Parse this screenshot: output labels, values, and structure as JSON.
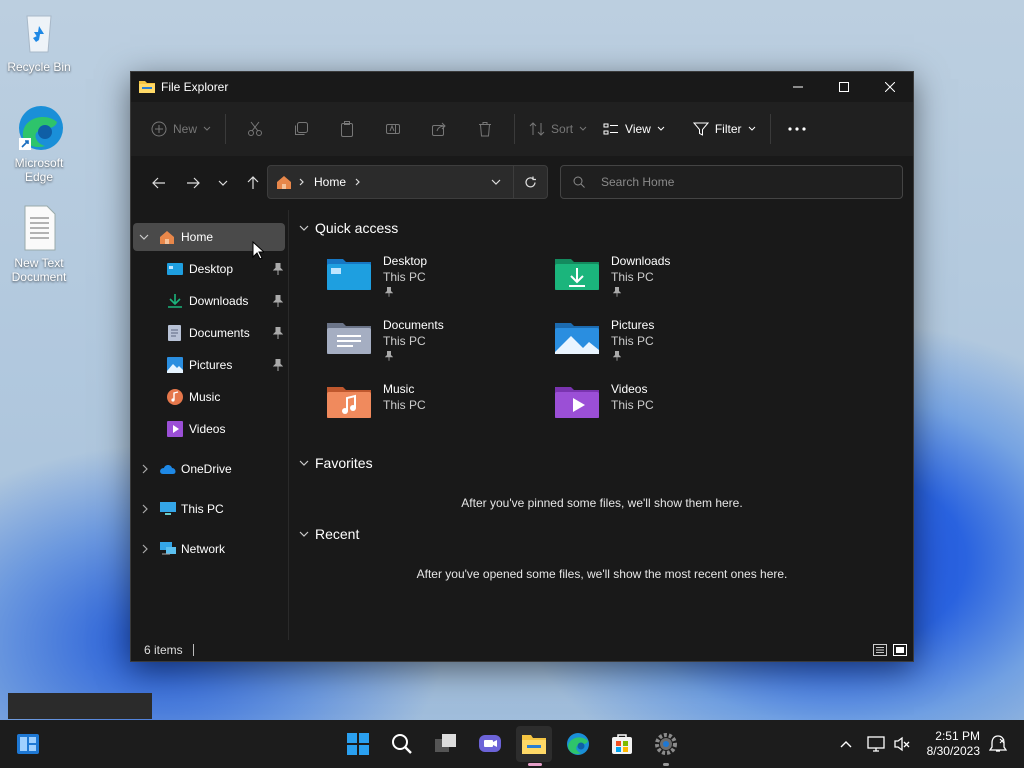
{
  "desktop": {
    "icons": [
      {
        "label": "Recycle Bin",
        "icon": "recycle-bin-icon"
      },
      {
        "label": "Microsoft Edge",
        "icon": "edge-icon"
      },
      {
        "label": "New Text Document",
        "icon": "text-document-icon"
      }
    ]
  },
  "window": {
    "title": "File Explorer",
    "toolbar": {
      "new_label": "New",
      "sort_label": "Sort",
      "view_label": "View",
      "filter_label": "Filter"
    },
    "address": {
      "location": "Home"
    },
    "search": {
      "placeholder": "Search Home"
    },
    "sidebar": {
      "home": "Home",
      "items": [
        {
          "label": "Desktop",
          "pinned": true
        },
        {
          "label": "Downloads",
          "pinned": true
        },
        {
          "label": "Documents",
          "pinned": true
        },
        {
          "label": "Pictures",
          "pinned": true
        },
        {
          "label": "Music",
          "pinned": false
        },
        {
          "label": "Videos",
          "pinned": false
        }
      ],
      "onedrive": "OneDrive",
      "thispc": "This PC",
      "network": "Network"
    },
    "quick_access": {
      "heading": "Quick access",
      "items": [
        {
          "name": "Desktop",
          "location": "This PC",
          "pinned": true,
          "color": "#1e9fe0"
        },
        {
          "name": "Downloads",
          "location": "This PC",
          "pinned": true,
          "color": "#1bb57c"
        },
        {
          "name": "Documents",
          "location": "This PC",
          "pinned": true,
          "color": "#8a94a8"
        },
        {
          "name": "Pictures",
          "location": "This PC",
          "pinned": true,
          "color": "#2a8ee0"
        },
        {
          "name": "Music",
          "location": "This PC",
          "pinned": false,
          "color": "#e5774b"
        },
        {
          "name": "Videos",
          "location": "This PC",
          "pinned": false,
          "color": "#9b4fd6"
        }
      ]
    },
    "favorites": {
      "heading": "Favorites",
      "empty_message": "After you've pinned some files, we'll show them here."
    },
    "recent": {
      "heading": "Recent",
      "empty_message": "After you've opened some files, we'll show the most recent ones here."
    },
    "status": {
      "items_count": "6 items"
    }
  },
  "taskbar": {
    "time": "2:51 PM",
    "date": "8/30/2023"
  }
}
